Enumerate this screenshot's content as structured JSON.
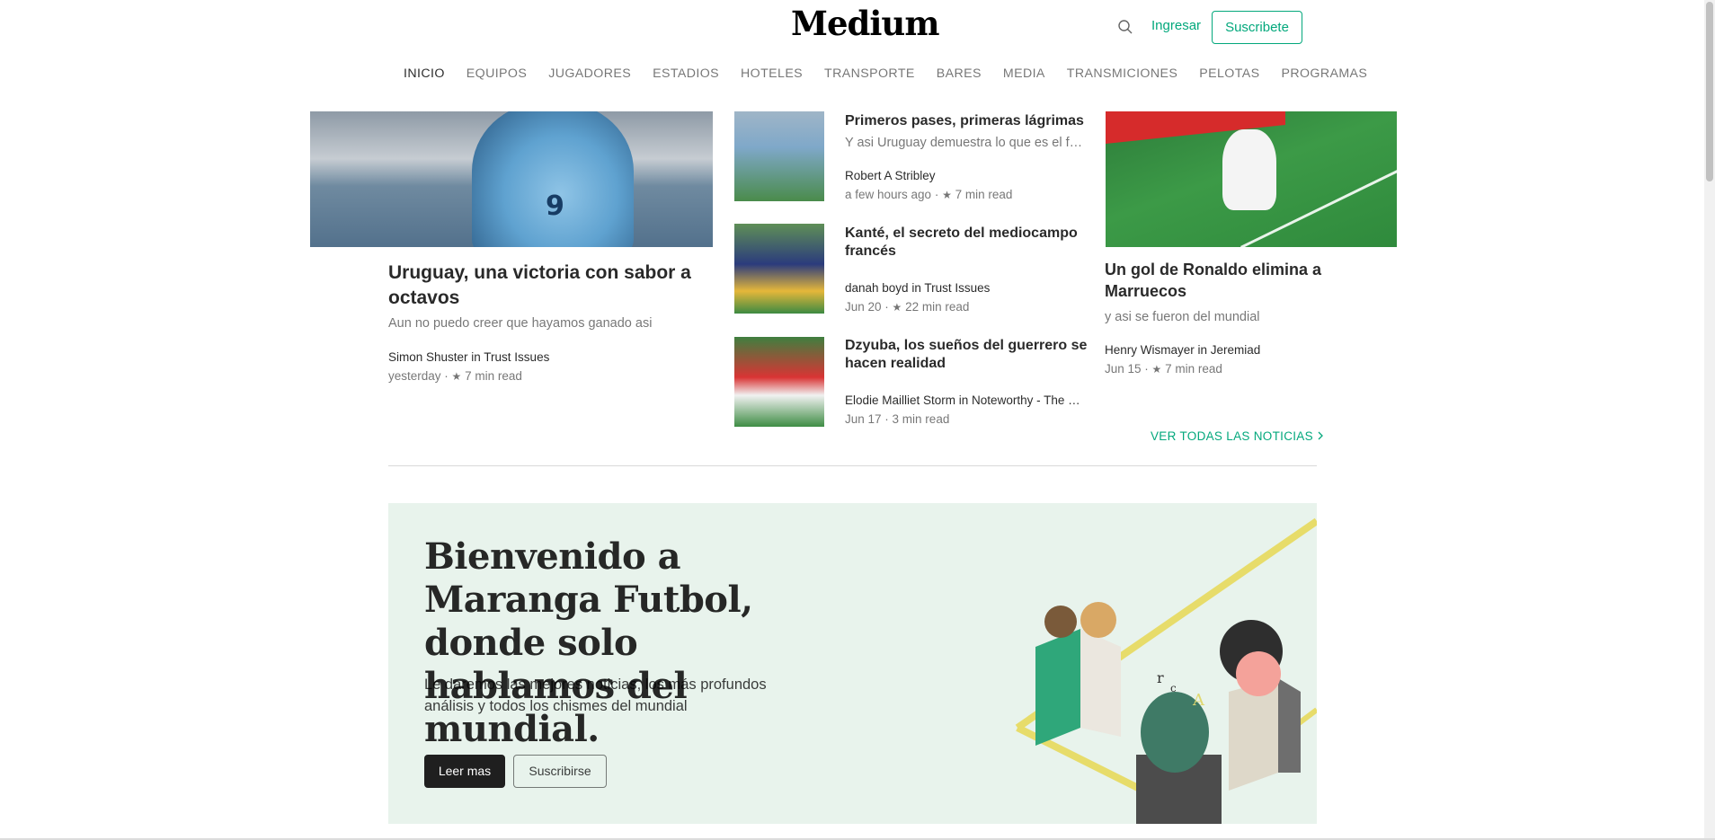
{
  "header": {
    "logo": "Medium",
    "signin_label": "Ingresar",
    "subscribe_label": "Suscribete",
    "accent_color": "#03a87c"
  },
  "nav": {
    "items": [
      "INICIO",
      "EQUIPOS",
      "JUGADORES",
      "ESTADIOS",
      "HOTELES",
      "TRANSPORTE",
      "BARES",
      "MEDIA",
      "TRANSMICIONES",
      "PELOTAS",
      "PROGRAMAS"
    ],
    "active": "INICIO"
  },
  "stories": {
    "hero": {
      "title": "Uruguay, una victoria con sabor a octavos",
      "subtitle": "Aun no puedo creer que hayamos ganado asi",
      "author": "Simon Shuster in Trust Issues",
      "date": "yesterday",
      "read_time": "7 min read"
    },
    "list": [
      {
        "title": "Primeros pases, primeras lágrimas",
        "subtitle": "Y asi Uruguay demuestra lo que es el fut…",
        "author": "Robert A Stribley",
        "date": "a few hours ago",
        "read_time": "7 min read"
      },
      {
        "title": "Kanté, el secreto del mediocampo francés",
        "author": "danah boyd in Trust Issues",
        "date": "Jun 20",
        "read_time": "22 min read"
      },
      {
        "title": "Dzyuba, los sueños del guerrero se hacen realidad",
        "author": "Elodie Mailliet Storm in Noteworthy - The …",
        "date": "Jun 17",
        "read_time": "3 min read"
      }
    ],
    "right": {
      "title": "Un gol de Ronaldo elimina a Marruecos",
      "subtitle": "y asi se fueron del mundial",
      "author": "Henry Wismayer in Jeremiad",
      "date": "Jun 15",
      "read_time": "7 min read"
    },
    "see_all_label": "VER TODAS LAS NOTICIAS"
  },
  "promo": {
    "title": "Bienvenido a Maranga Futbol, donde solo hablamos del mundial.",
    "subtitle": "Le daremos las mejores noticias, los más profundos análisis y todos los chismes del mundial",
    "read_label": "Leer mas",
    "subscribe_label": "Suscribirse"
  }
}
